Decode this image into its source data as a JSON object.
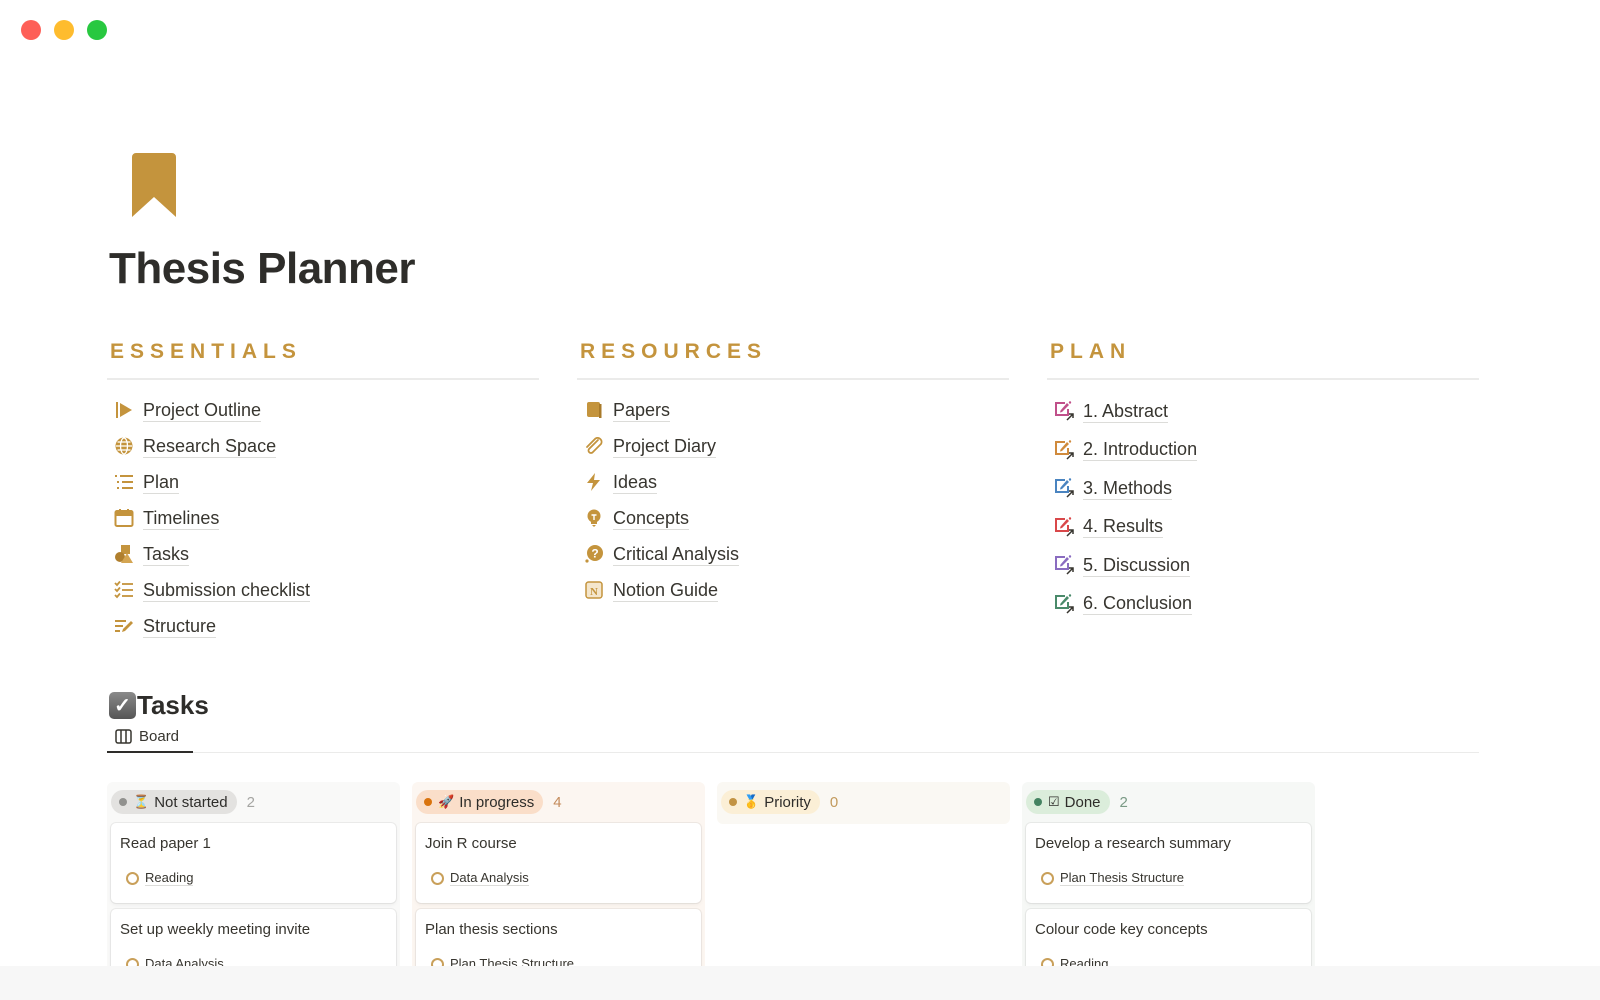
{
  "window": {
    "controls": [
      "close",
      "minimize",
      "maximize"
    ]
  },
  "page": {
    "icon": "bookmark-icon",
    "title": "Thesis Planner",
    "accent_color": "#c4943d"
  },
  "sections": {
    "essentials": {
      "heading": "ESSENTIALS",
      "items": [
        {
          "label": "Project Outline",
          "icon": "flag-icon"
        },
        {
          "label": "Research Space",
          "icon": "globe-icon"
        },
        {
          "label": "Plan",
          "icon": "list-icon"
        },
        {
          "label": "Timelines",
          "icon": "calendar-icon"
        },
        {
          "label": "Tasks",
          "icon": "shapes-icon"
        },
        {
          "label": "Submission checklist",
          "icon": "checklist-icon"
        },
        {
          "label": "Structure",
          "icon": "edit-list-icon"
        }
      ]
    },
    "resources": {
      "heading": "RESOURCES",
      "items": [
        {
          "label": "Papers",
          "icon": "book-icon"
        },
        {
          "label": "Project Diary",
          "icon": "paperclip-icon"
        },
        {
          "label": "Ideas",
          "icon": "lightning-icon"
        },
        {
          "label": "Concepts",
          "icon": "lightbulb-icon"
        },
        {
          "label": "Critical Analysis",
          "icon": "question-bubble-icon"
        },
        {
          "label": "Notion Guide",
          "icon": "notion-icon"
        }
      ]
    },
    "plan": {
      "heading": "PLAN",
      "items": [
        {
          "label": "1. Abstract",
          "icon": "edit-link-icon",
          "color": "#c0508a"
        },
        {
          "label": "2. Introduction",
          "icon": "edit-link-icon",
          "color": "#d08a3c"
        },
        {
          "label": "3. Methods",
          "icon": "edit-link-icon",
          "color": "#4a84c0"
        },
        {
          "label": "4. Results",
          "icon": "edit-link-icon",
          "color": "#d9484a"
        },
        {
          "label": "5. Discussion",
          "icon": "edit-link-icon",
          "color": "#8a6cc0"
        },
        {
          "label": "6. Conclusion",
          "icon": "edit-link-icon",
          "color": "#4a8a6a"
        }
      ]
    }
  },
  "tasks": {
    "title": "Tasks",
    "views": [
      {
        "label": "Board",
        "icon": "board-icon",
        "active": true
      }
    ],
    "columns": [
      {
        "label": "Not started",
        "emoji": "⏳",
        "count": "2",
        "bg": "#f9f9f8",
        "pill_bg": "#e3e2e0",
        "dot": "#91918e",
        "count_color": "#a5a5a2",
        "cards": [
          {
            "title": "Read paper 1",
            "tag": "Reading"
          },
          {
            "title": "Set up weekly meeting invite",
            "tag": "Data Analysis"
          }
        ]
      },
      {
        "label": "In progress",
        "emoji": "🚀",
        "count": "4",
        "bg": "#fcf6f1",
        "pill_bg": "#fadec9",
        "dot": "#d9730d",
        "count_color": "#c48b5c",
        "cards": [
          {
            "title": "Join R course",
            "tag": "Data Analysis"
          },
          {
            "title": "Plan thesis sections",
            "tag": "Plan Thesis Structure"
          }
        ]
      },
      {
        "label": "Priority",
        "emoji": "🥇",
        "count": "0",
        "bg": "#faf8f3",
        "pill_bg": "#fbefd6",
        "dot": "#c29343",
        "count_color": "#c29a5c",
        "cards": []
      },
      {
        "label": "Done",
        "emoji": "☑",
        "count": "2",
        "bg": "#f6f8f6",
        "pill_bg": "#dbeddb",
        "dot": "#448361",
        "count_color": "#7a9a85",
        "cards": [
          {
            "title": "Develop a research summary",
            "tag": "Plan Thesis Structure"
          },
          {
            "title": "Colour code key concepts",
            "tag": "Reading"
          }
        ]
      }
    ]
  }
}
